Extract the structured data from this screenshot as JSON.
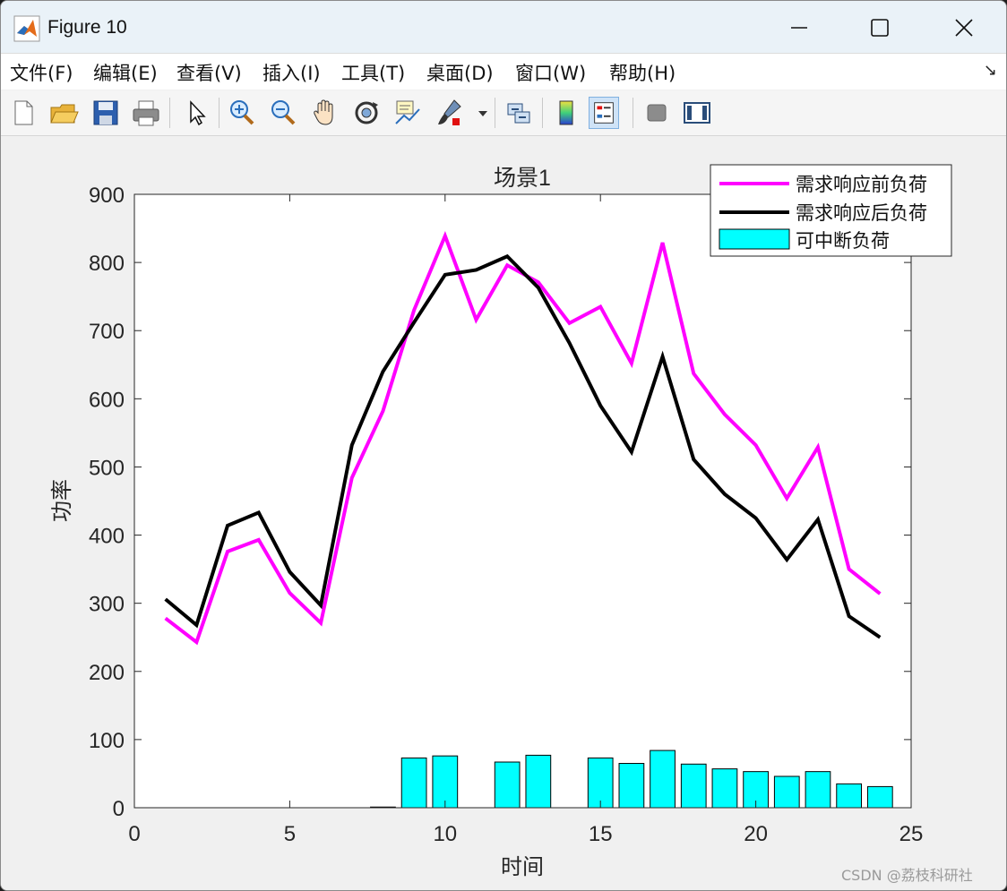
{
  "window": {
    "title": "Figure 10"
  },
  "menu": [
    "文件(F)",
    "编辑(E)",
    "查看(V)",
    "插入(I)",
    "工具(T)",
    "桌面(D)",
    "窗口(W)",
    "帮助(H)"
  ],
  "toolbar": {
    "icons": [
      "new-figure-icon",
      "open-file-icon",
      "save-icon",
      "print-icon",
      "select-pointer-icon",
      "zoom-in-icon",
      "zoom-out-icon",
      "pan-hand-icon",
      "rotate-3d-icon",
      "data-cursor-icon",
      "brush-icon",
      "link-plot-icon",
      "colorbar-icon",
      "legend-icon",
      "hide-plot-tools-icon",
      "show-plot-tools-icon"
    ]
  },
  "chart_data": {
    "type": "line",
    "title": "场景1",
    "xlabel": "时间",
    "ylabel": "功率",
    "xlim": [
      0,
      25
    ],
    "ylim": [
      0,
      900
    ],
    "xticks": [
      "0",
      "5",
      "10",
      "15",
      "20",
      "25"
    ],
    "yticks": [
      "0",
      "100",
      "200",
      "300",
      "400",
      "500",
      "600",
      "700",
      "800",
      "900"
    ],
    "grid": false,
    "legend_position": "top-right",
    "x": [
      1,
      2,
      3,
      4,
      5,
      6,
      7,
      8,
      9,
      10,
      11,
      12,
      13,
      14,
      15,
      16,
      17,
      18,
      19,
      20,
      21,
      22,
      23,
      24
    ],
    "series": [
      {
        "name": "需求响应前负荷",
        "kind": "line",
        "color": "#ff00ff",
        "values": [
          278,
          243,
          376,
          393,
          315,
          271,
          484,
          582,
          730,
          839,
          716,
          796,
          771,
          711,
          735,
          652,
          829,
          637,
          577,
          532,
          454,
          529,
          350,
          314
        ]
      },
      {
        "name": "需求响应后负荷",
        "kind": "line",
        "color": "#000000",
        "values": [
          306,
          268,
          414,
          433,
          346,
          297,
          532,
          640,
          712,
          782,
          789,
          809,
          763,
          682,
          590,
          522,
          662,
          511,
          460,
          425,
          364,
          423,
          281,
          250
        ]
      },
      {
        "name": "可中断负荷",
        "kind": "bar",
        "color": "#00ffff",
        "values": [
          0,
          0,
          0,
          0,
          0,
          0,
          0,
          1,
          73,
          76,
          0,
          67,
          77,
          0,
          73,
          65,
          84,
          64,
          57,
          53,
          46,
          53,
          35,
          31
        ]
      }
    ]
  },
  "watermark": "CSDN @荔枝科研社"
}
